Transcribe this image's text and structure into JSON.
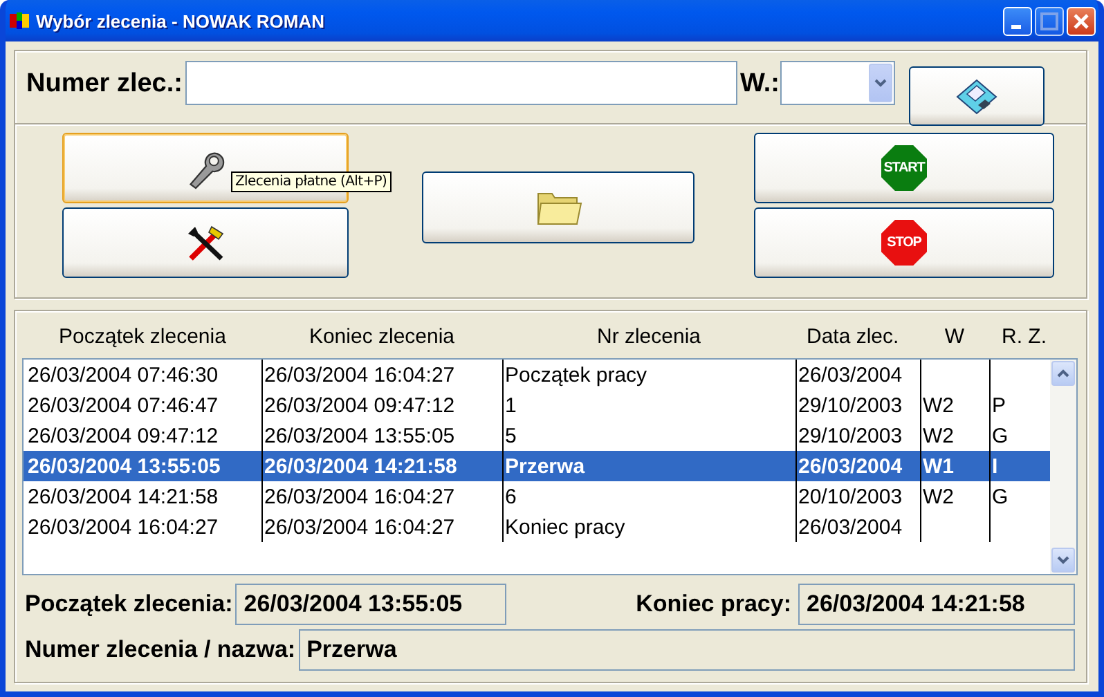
{
  "window": {
    "title": "Wybór zlecenia - NOWAK ROMAN"
  },
  "search": {
    "label": "Numer zlec.:",
    "w_label": "W.:"
  },
  "save_button": {
    "focused": false
  },
  "tool_buttons": [
    {
      "kind": "wrench",
      "focused": true
    },
    {
      "kind": "tools",
      "focused": false
    }
  ],
  "folder_button": {
    "focused": false
  },
  "sign_buttons": [
    {
      "kind": "start",
      "label": "START",
      "focused": false
    },
    {
      "kind": "stop",
      "label": "STOP",
      "focused": false
    }
  ],
  "tooltip": "Zlecenia płatne  (Alt+P)",
  "table": {
    "columns": [
      "Początek zlecenia",
      "Koniec zlecenia",
      "Nr zlecenia",
      "Data zlec.",
      "W",
      "R. Z."
    ],
    "rows": [
      {
        "cells": [
          "26/03/2004 07:46:30",
          "26/03/2004 16:04:27",
          "Początek pracy",
          "26/03/2004",
          null,
          null
        ],
        "selected": false
      },
      {
        "cells": [
          "26/03/2004 07:46:47",
          "26/03/2004 09:47:12",
          "1",
          "29/10/2003",
          "W2",
          "P"
        ],
        "selected": false
      },
      {
        "cells": [
          "26/03/2004 09:47:12",
          "26/03/2004 13:55:05",
          "5",
          "29/10/2003",
          "W2",
          "G"
        ],
        "selected": false
      },
      {
        "cells": [
          "26/03/2004 13:55:05",
          "26/03/2004 14:21:58",
          "Przerwa",
          "26/03/2004",
          "W1",
          "I"
        ],
        "selected": true
      },
      {
        "cells": [
          "26/03/2004 14:21:58",
          "26/03/2004 16:04:27",
          "6",
          "20/10/2003",
          "W2",
          "G"
        ],
        "selected": false
      },
      {
        "cells": [
          "26/03/2004 16:04:27",
          "26/03/2004 16:04:27",
          "Koniec pracy",
          "26/03/2004",
          null,
          null
        ],
        "selected": false
      }
    ]
  },
  "details": {
    "start_label": "Początek zlecenia:",
    "start_value": "26/03/2004 13:55:05",
    "end_label": "Koniec pracy:",
    "end_value": "26/03/2004 14:21:58",
    "name_label": "Numer zlecenia / nazwa:",
    "name_value": "Przerwa"
  }
}
